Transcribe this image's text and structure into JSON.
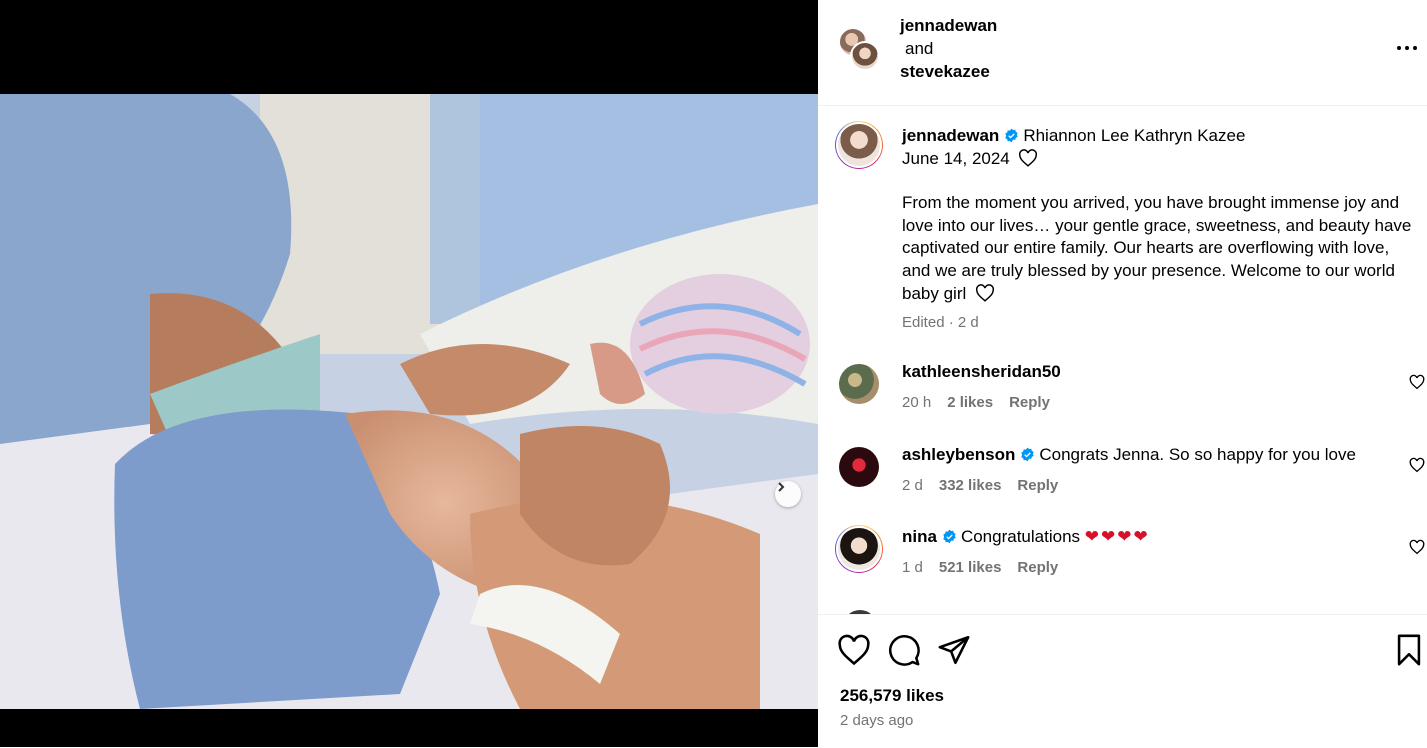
{
  "post": {
    "carousel": {
      "current_slide": 1,
      "slide_count": 2
    }
  },
  "header": {
    "user1": "jennadewan",
    "joiner": "and",
    "user2": "stevekazee"
  },
  "caption": {
    "username": "jennadewan",
    "title_line": "Rhiannon Lee Kathryn Kazee",
    "date_line": "June 14, 2024",
    "body": "From the moment you arrived, you have brought immense joy and love into our lives… your gentle grace, sweetness, and beauty have captivated our entire family. Our hearts are overflowing with love, and we are truly blessed by your presence. Welcome to our world baby girl",
    "meta": "Edited · 2 d"
  },
  "comments": [
    {
      "username": "kathleensheridan50",
      "text": "",
      "time": "20 h",
      "likes": "2 likes",
      "reply": "Reply"
    },
    {
      "username": "ashleybenson",
      "text": "Congrats Jenna. So so happy for you love",
      "time": "2 d",
      "likes": "332 likes",
      "reply": "Reply"
    },
    {
      "username": "nina",
      "text": "Congratulations",
      "hearts": "❤❤❤❤",
      "time": "1 d",
      "likes": "521 likes",
      "reply": "Reply"
    }
  ],
  "footer": {
    "likes": "256,579 likes",
    "time": "2 days ago"
  },
  "colors": {
    "verified": "#0095f6",
    "muted": "#737373"
  }
}
